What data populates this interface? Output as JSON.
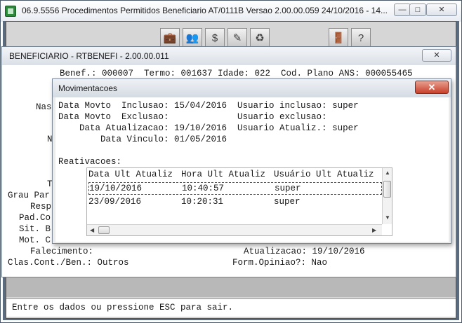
{
  "window": {
    "title": "06.9.5556 Procedimentos Permitidos Beneficiario AT/0111B Versao 2.00.00.059 24/10/2016 - 14...",
    "min_label": "—",
    "max_label": "□",
    "close_label": "✕"
  },
  "toolbar": {
    "icons": [
      "briefcase-icon",
      "people-icon",
      "money-doc-icon",
      "stamp-icon",
      "recycle-icon",
      "exit-door-icon",
      "help-icon"
    ],
    "glyphs": [
      "💼",
      "👥",
      "$",
      "✎",
      "♻",
      "🚪",
      "?"
    ]
  },
  "benef": {
    "title": "BENEFICIARIO - RTBENEFI - 2.00.00.011",
    "close_label": "✕",
    "header_line": "Benef.: 000007  Termo: 001637 Idade: 022  Cod. Plano ANS: 000055465",
    "left_labels": {
      "nas": "Nas",
      "n": "N",
      "t": "T",
      "grau": "Grau Par",
      "resp": "Resp",
      "pad": "Pad.Co",
      "sit": "Sit. B",
      "mot": "Mot. C"
    },
    "falecimento_line": "Falecimento:",
    "atualizacao_line": "Atualizacao: 19/10/2016",
    "clas_line": "Clas.Cont./Ben.: Outros",
    "form_line": "Form.Opiniao?: Nao"
  },
  "status_bar": {
    "message": "Entre os dados ou pressione ESC para sair."
  },
  "mov": {
    "title": "Movimentacoes",
    "close_label": "✕",
    "lines": [
      "Data Movto  Inclusao: 15/04/2016  Usuario inclusao: super",
      "Data Movto  Exclusao:             Usuario exclusao:",
      "    Data Atualizacao: 19/10/2016  Usuario Atualiz.: super",
      "        Data Vinculo: 01/05/2016"
    ],
    "reativacoes_label": "Reativacoes:",
    "grid": {
      "columns": [
        "Data Ult Atualiz",
        "Hora Ult Atualiz",
        "Usuário Ult Atualiz"
      ],
      "rows": [
        [
          "19/10/2016",
          "10:40:57",
          "super"
        ],
        [
          "23/09/2016",
          "10:20:31",
          "super"
        ]
      ]
    }
  }
}
